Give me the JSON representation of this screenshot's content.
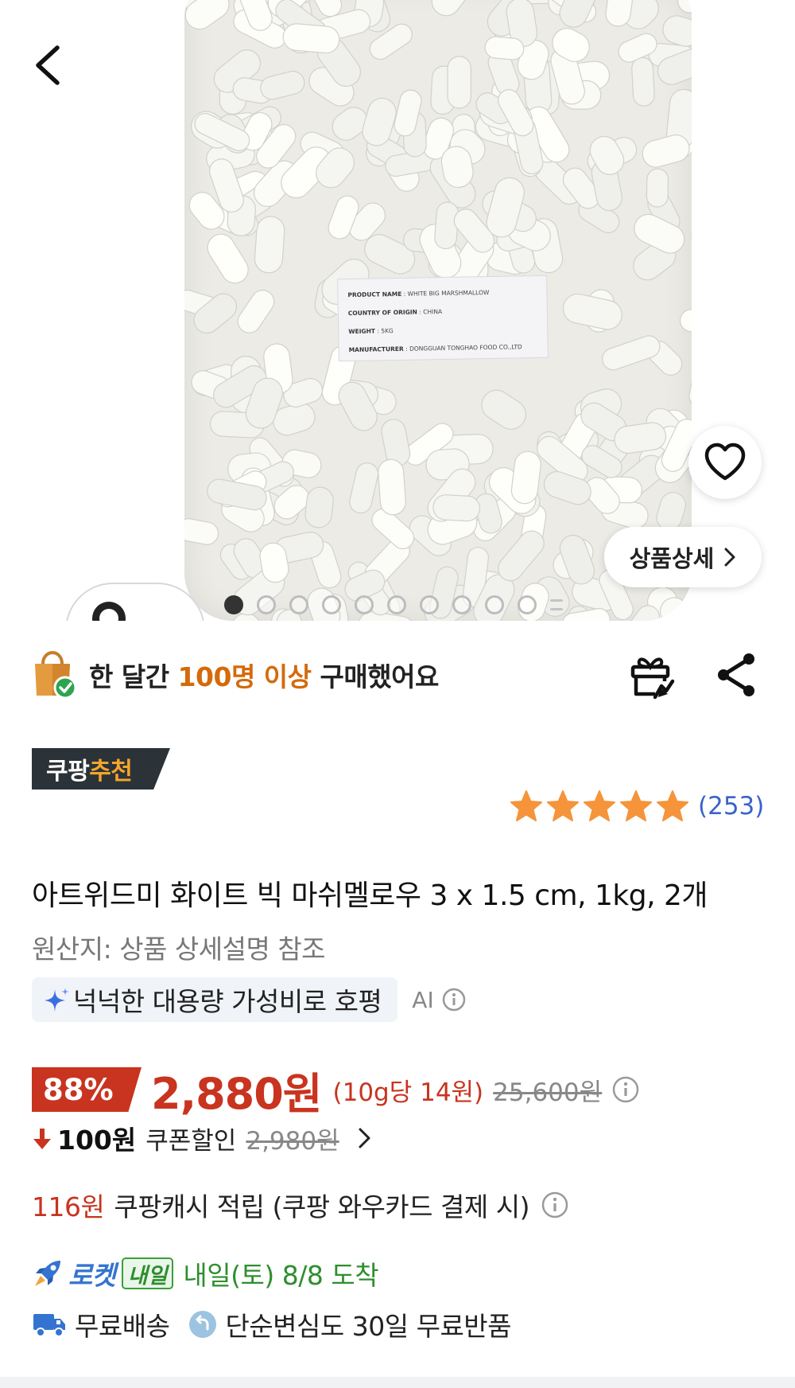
{
  "hero": {
    "product_label_lines": [
      {
        "key": "PRODUCT NAME",
        "value": ": WHITE BIG MARSHMALLOW"
      },
      {
        "key": "COUNTRY OF ORIGIN",
        "value": ": CHINA"
      },
      {
        "key": "WEIGHT",
        "value": ": 5KG"
      },
      {
        "key": "MANUFACTURER",
        "value": ": DONGGUAN TONGHAO FOOD CO.,LTD"
      }
    ],
    "detail_button_label": "상품상세",
    "carousel_total_dots": 10,
    "carousel_active_index": 0
  },
  "social_proof": {
    "prefix": "한 달간",
    "highlight": "100명 이상",
    "suffix": "구매했어요"
  },
  "badge": {
    "part1": "쿠팡",
    "part2": "추천"
  },
  "rating": {
    "stars": 5,
    "count_text": "(253)"
  },
  "product": {
    "title": "아트위드미 화이트 빅 마쉬멜로우 3 x 1.5 cm, 1kg, 2개",
    "origin": "원산지: 상품 상세설명 참조"
  },
  "ai_summary": {
    "text": "넉넉한 대용량 가성비로 호평",
    "label": "AI"
  },
  "price": {
    "discount": "88%",
    "current": "2,880원",
    "unit": "(10g당 14원)",
    "original": "25,600원"
  },
  "coupon": {
    "amount": "100원",
    "label": "쿠폰할인",
    "before": "2,980원"
  },
  "cash": {
    "amount": "116원",
    "label": "쿠팡캐시 적립 (쿠팡 와우카드 결제 시)"
  },
  "delivery": {
    "rocket_label": "로켓",
    "tomorrow_badge": "내일",
    "arrival": "내일(토) 8/8 도착",
    "free_shipping": "무료배송",
    "return_policy": "단순변심도 30일 무료반품"
  },
  "colors": {
    "accent_red": "#c8341f",
    "accent_orange": "#d46a0b",
    "star_orange": "#f5943a",
    "rocket_blue": "#3474d0",
    "arrival_green": "#2f8e2f",
    "review_blue": "#3a63c9"
  },
  "icons": {
    "back": "chevron-left-icon",
    "favorite": "heart-outline-icon",
    "gift": "gift-icon",
    "share": "share-icon",
    "shopping_bag": "shopping-bag-check-icon",
    "sparkle": "sparkle-icon",
    "info": "info-circle-icon",
    "down_arrow": "arrow-down-icon",
    "rocket": "rocket-icon",
    "truck": "truck-icon",
    "return": "return-arrow-icon"
  }
}
